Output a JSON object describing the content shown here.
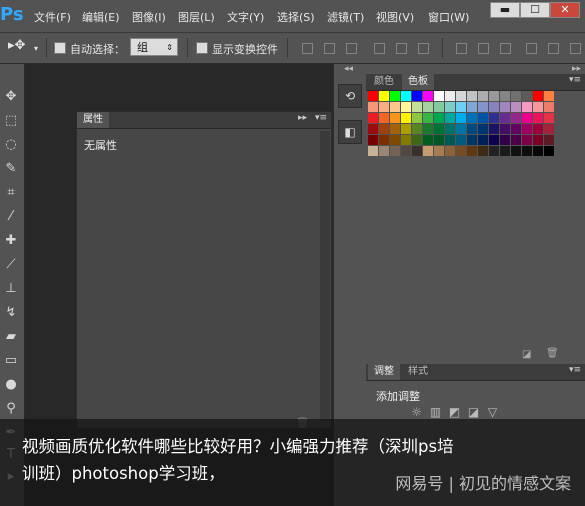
{
  "app": {
    "logo": "Ps"
  },
  "menu": [
    "文件(F)",
    "编辑(E)",
    "图像(I)",
    "图层(L)",
    "文字(Y)",
    "选择(S)",
    "滤镜(T)",
    "视图(V)",
    "窗口(W)"
  ],
  "window_buttons": {
    "minimize": "▬",
    "maximize": "☐",
    "close": "✕"
  },
  "options": {
    "auto_select_label": "自动选择：",
    "auto_select_value": "组",
    "show_transform_label": "显示变换控件"
  },
  "properties_panel": {
    "tab": "属性",
    "body_label": "无属性"
  },
  "right_panel": {
    "tabs": [
      "颜色",
      "色板"
    ],
    "adjust_tabs": [
      "调整",
      "样式"
    ],
    "adjust_label": "添加调整"
  },
  "colors": {
    "swatches": [
      "#ff0000",
      "#ffff00",
      "#00ff00",
      "#00ffff",
      "#0000ff",
      "#ff00ff",
      "#ffffff",
      "#ebebeb",
      "#d6d6d6",
      "#c2c2c2",
      "#adadad",
      "#999999",
      "#858585",
      "#707070",
      "#5c5c5c",
      "#ff0000",
      "#ff8040",
      "#f7977a",
      "#f9ad81",
      "#fdc68a",
      "#fff79a",
      "#c4df9b",
      "#a2d39c",
      "#82ca9d",
      "#7bcdc8",
      "#6ecff6",
      "#7ea7d8",
      "#8493ca",
      "#8882be",
      "#a187be",
      "#bc8dbf",
      "#f49ac2",
      "#f6989d",
      "#ee7b6a",
      "#ed1c24",
      "#f26522",
      "#f7941d",
      "#fff200",
      "#8dc63f",
      "#39b54a",
      "#00a651",
      "#00a99d",
      "#00aeef",
      "#0072bc",
      "#0054a6",
      "#2e3192",
      "#662d91",
      "#92278f",
      "#ec008c",
      "#ed145b",
      "#e63246",
      "#9e0b0f",
      "#a0410d",
      "#a36209",
      "#aba000",
      "#598527",
      "#1a7b30",
      "#007236",
      "#00746b",
      "#0076a3",
      "#004a80",
      "#003471",
      "#1b1464",
      "#440e62",
      "#630460",
      "#9e005d",
      "#9e0039",
      "#a0243a",
      "#790000",
      "#7b2e00",
      "#7d4900",
      "#827b00",
      "#406618",
      "#005e20",
      "#005826",
      "#005952",
      "#005b7f",
      "#003663",
      "#002157",
      "#0d004c",
      "#32004b",
      "#4b0049",
      "#7b0046",
      "#7a0026",
      "#5b1a24",
      "#c7b299",
      "#998675",
      "#736357",
      "#534741",
      "#37302d",
      "#c69c6d",
      "#a67c52",
      "#8c6239",
      "#754c24",
      "#603913",
      "#3f2a14",
      "#222222",
      "#1a1a1a",
      "#111111",
      "#0d0d0d",
      "#080808",
      "#000000"
    ]
  },
  "caption": {
    "line1": "视频画质优化软件哪些比较好用？小编强力推荐（深圳ps培",
    "line2": "训班）photoshop学习班，",
    "watermark": "网易号 | 初见的情感文案"
  }
}
